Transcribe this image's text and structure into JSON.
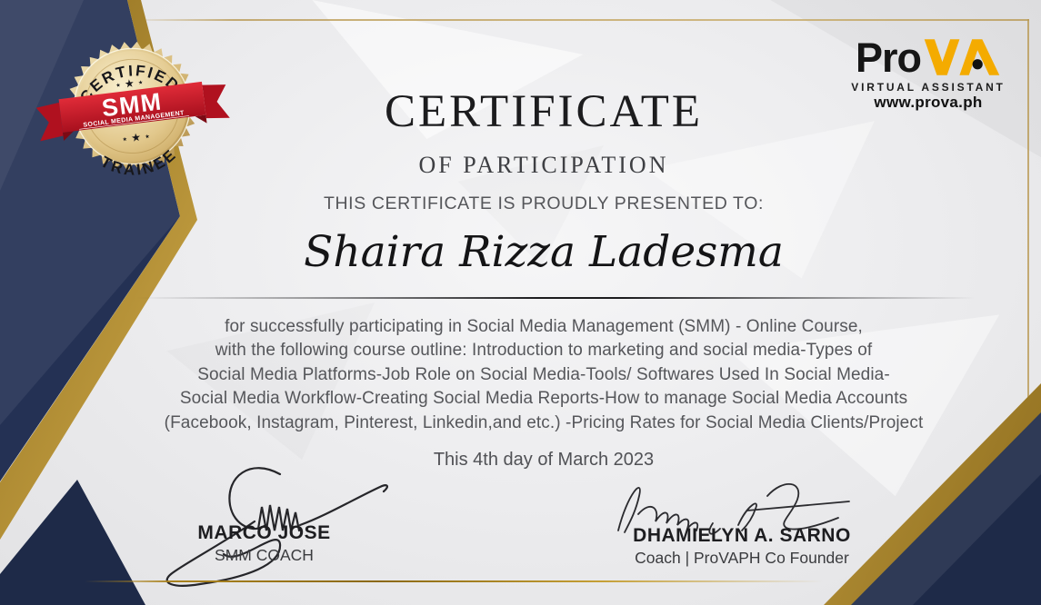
{
  "badge": {
    "arc_top": "CERTIFIED",
    "stars_top": "⋆ ★ ⋆",
    "ribbon_title": "SMM",
    "ribbon_subtitle": "SOCIAL MEDIA MANAGEMENT",
    "stars_bottom": "⋆ ★ ⋆",
    "arc_bottom": "TRAINEE"
  },
  "logo": {
    "word_black": "Pro",
    "word_gold": "VA",
    "tagline": "VIRTUAL ASSISTANT",
    "website": "www.prova.ph"
  },
  "header": {
    "title": "CERTIFICATE",
    "subtitle": "OF PARTICIPATION",
    "presented_to": "THIS CERTIFICATE IS PROUDLY PRESENTED TO:"
  },
  "recipient": {
    "name": "Shaira Rizza Ladesma"
  },
  "body": {
    "lines": [
      "for successfully participating in Social Media Management (SMM) - Online Course,",
      "with the following course outline: Introduction to marketing and social media-Types of",
      "Social Media Platforms-Job Role on Social Media-Tools/ Softwares Used In Social Media-",
      "Social Media Workflow-Creating Social Media Reports-How to manage Social Media Accounts",
      "(Facebook, Instagram, Pinterest, Linkedin,and etc.) -Pricing Rates for Social Media Clients/Project"
    ]
  },
  "date_line": "This 4th day of March 2023",
  "signatures": [
    {
      "name": "MARCO JOSE",
      "title": "SMM COACH"
    },
    {
      "name": "DHAMIELYN A. SARNO",
      "title": "Coach | ProVAPH Co Founder"
    }
  ],
  "colors": {
    "navy": "#243154",
    "gold": "#c9a445",
    "ribbon_red": "#c4202e",
    "logo_yellow": "#f4ab00",
    "body_gray": "#55565a"
  }
}
